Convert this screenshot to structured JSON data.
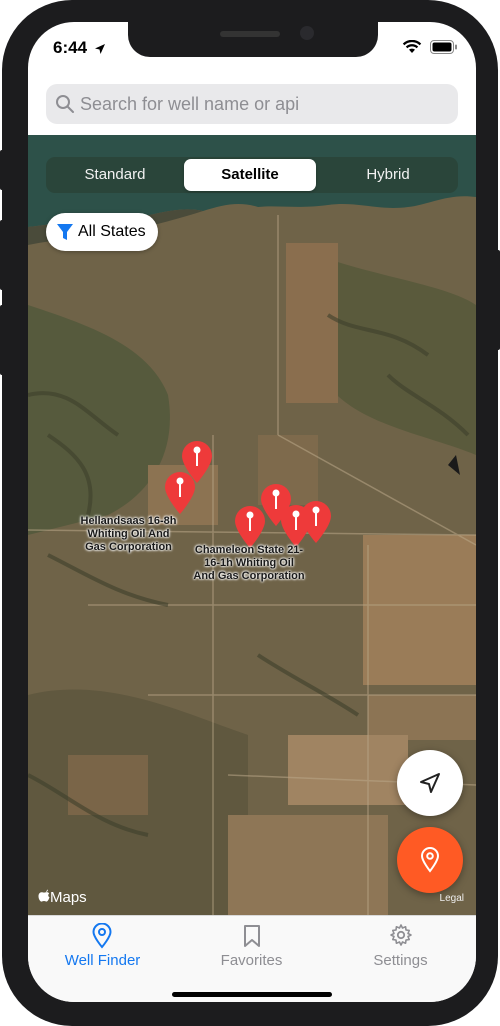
{
  "status": {
    "time": "6:44"
  },
  "search": {
    "placeholder": "Search for well name or api"
  },
  "map": {
    "map_types": [
      {
        "label": "Standard",
        "selected": false
      },
      {
        "label": "Satellite",
        "selected": true
      },
      {
        "label": "Hybrid",
        "selected": false
      }
    ],
    "filter_label": "All States",
    "labels": {
      "hellandsaas": [
        "Hellandsaas 16-8h",
        "Whiting Oil And",
        "Gas Corporation"
      ],
      "chameleon": [
        "Chameleon State 21-",
        "16-1h Whiting Oil",
        "And Gas Corporation"
      ]
    },
    "maps_logo": "Maps",
    "legal": "Legal"
  },
  "colors": {
    "accent": "#1478f0",
    "pin": "#ee3a3a",
    "fab_orange": "#ff5a24",
    "tab_inactive": "#8e8e93"
  },
  "tabs": [
    {
      "label": "Well Finder",
      "icon": "location-pin-icon",
      "active": true
    },
    {
      "label": "Favorites",
      "icon": "bookmark-icon",
      "active": false
    },
    {
      "label": "Settings",
      "icon": "gear-icon",
      "active": false
    }
  ]
}
